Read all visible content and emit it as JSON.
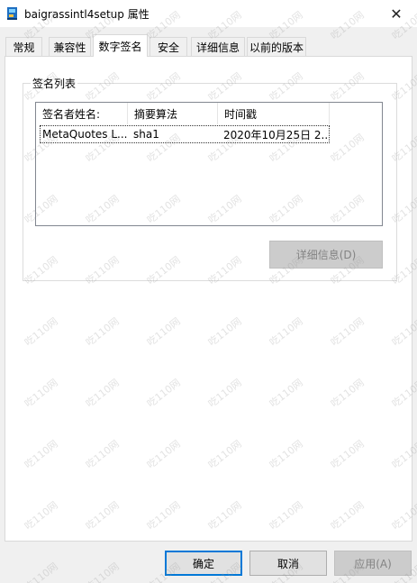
{
  "window": {
    "title": "baigrassintl4setup 属性",
    "close_glyph": "✕"
  },
  "tabs": [
    {
      "label": "常规"
    },
    {
      "label": "兼容性"
    },
    {
      "label": "数字签名",
      "active": true
    },
    {
      "label": "安全"
    },
    {
      "label": "详细信息"
    },
    {
      "label": "以前的版本"
    }
  ],
  "signature_group": {
    "label": "签名列表",
    "columns": [
      "签名者姓名:",
      "摘要算法",
      "时间戳"
    ],
    "rows": [
      {
        "name": "MetaQuotes L...",
        "algorithm": "sha1",
        "timestamp": "2020年10月25日 2..."
      }
    ],
    "details_button": "详细信息(D)"
  },
  "footer": {
    "ok_label": "确定",
    "cancel_label": "取消",
    "apply_label": "应用(A)"
  },
  "watermark": {
    "text": "吃110网"
  },
  "colors": {
    "accent": "#0078d7",
    "window_bg": "#f0f0f0",
    "panel_bg": "#ffffff"
  }
}
